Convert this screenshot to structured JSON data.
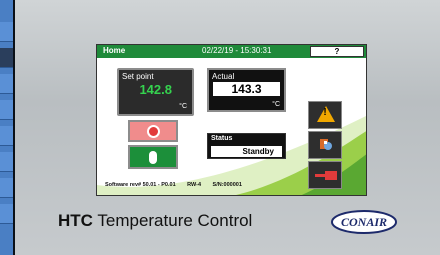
{
  "screen": {
    "title": "Home",
    "datetime": "02/22/19 - 15:30:31",
    "help_label": "?"
  },
  "setpoint": {
    "label": "Set point",
    "value": "142.8",
    "unit": "°C"
  },
  "actual": {
    "label": "Actual",
    "value": "143.3",
    "unit": "°C"
  },
  "status": {
    "label": "Status",
    "value": "Standby"
  },
  "side_buttons": [
    {
      "icon": "warning-icon"
    },
    {
      "icon": "boot-icon"
    },
    {
      "icon": "plug-icon"
    }
  ],
  "footer": {
    "software": "Software rev# 50.01 - P0.01",
    "rw": "RW-4",
    "serial": "S/N:000001"
  },
  "brand": {
    "product_bold": "HTC",
    "product_rest": "Temperature Control",
    "logo": "CONAIR"
  },
  "colors": {
    "titlebar": "#1f8a3a",
    "setpoint_value": "#35d24f",
    "stop": "#e23b3b",
    "start": "#1c8f3a",
    "warning": "#f1a800",
    "sidebar": "#4a7fc4"
  }
}
